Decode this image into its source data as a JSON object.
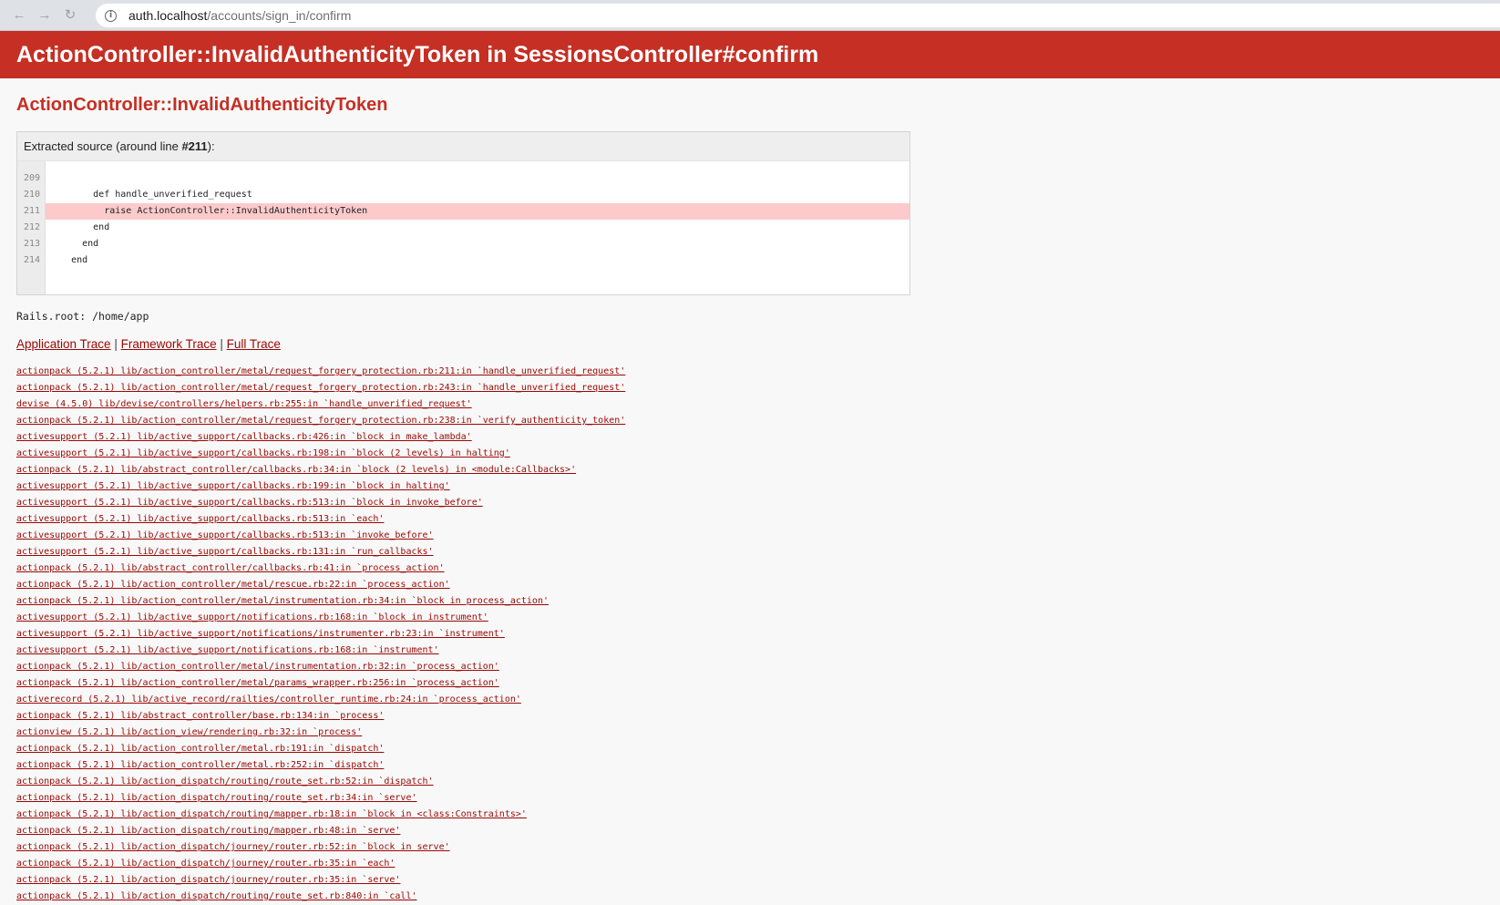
{
  "browser": {
    "url_host": "auth.localhost",
    "url_path": "/accounts/sign_in/confirm"
  },
  "header": {
    "title": "ActionController::InvalidAuthenticityToken in SessionsController#confirm"
  },
  "exception": {
    "name": "ActionController::InvalidAuthenticityToken"
  },
  "source": {
    "heading_prefix": "Extracted source (around line ",
    "heading_line": "#211",
    "heading_suffix": "):",
    "line_numbers": [
      "209",
      "210",
      "211",
      "212",
      "213",
      "214"
    ],
    "lines": [
      "",
      "        def handle_unverified_request",
      "          raise ActionController::InvalidAuthenticityToken",
      "        end",
      "      end",
      "    end"
    ],
    "highlighted_line": "211"
  },
  "rails_root": "Rails.root: /home/app",
  "trace_links": {
    "application": "Application Trace",
    "separator": " | ",
    "framework": "Framework Trace",
    "full": "Full Trace"
  },
  "trace": [
    "actionpack (5.2.1) lib/action_controller/metal/request_forgery_protection.rb:211:in `handle_unverified_request'",
    "actionpack (5.2.1) lib/action_controller/metal/request_forgery_protection.rb:243:in `handle_unverified_request'",
    "devise (4.5.0) lib/devise/controllers/helpers.rb:255:in `handle_unverified_request'",
    "actionpack (5.2.1) lib/action_controller/metal/request_forgery_protection.rb:238:in `verify_authenticity_token'",
    "activesupport (5.2.1) lib/active_support/callbacks.rb:426:in `block in make_lambda'",
    "activesupport (5.2.1) lib/active_support/callbacks.rb:198:in `block (2 levels) in halting'",
    "actionpack (5.2.1) lib/abstract_controller/callbacks.rb:34:in `block (2 levels) in <module:Callbacks>'",
    "activesupport (5.2.1) lib/active_support/callbacks.rb:199:in `block in halting'",
    "activesupport (5.2.1) lib/active_support/callbacks.rb:513:in `block in invoke_before'",
    "activesupport (5.2.1) lib/active_support/callbacks.rb:513:in `each'",
    "activesupport (5.2.1) lib/active_support/callbacks.rb:513:in `invoke_before'",
    "activesupport (5.2.1) lib/active_support/callbacks.rb:131:in `run_callbacks'",
    "actionpack (5.2.1) lib/abstract_controller/callbacks.rb:41:in `process_action'",
    "actionpack (5.2.1) lib/action_controller/metal/rescue.rb:22:in `process_action'",
    "actionpack (5.2.1) lib/action_controller/metal/instrumentation.rb:34:in `block in process_action'",
    "activesupport (5.2.1) lib/active_support/notifications.rb:168:in `block in instrument'",
    "activesupport (5.2.1) lib/active_support/notifications/instrumenter.rb:23:in `instrument'",
    "activesupport (5.2.1) lib/active_support/notifications.rb:168:in `instrument'",
    "actionpack (5.2.1) lib/action_controller/metal/instrumentation.rb:32:in `process_action'",
    "actionpack (5.2.1) lib/action_controller/metal/params_wrapper.rb:256:in `process_action'",
    "activerecord (5.2.1) lib/active_record/railties/controller_runtime.rb:24:in `process_action'",
    "actionpack (5.2.1) lib/abstract_controller/base.rb:134:in `process'",
    "actionview (5.2.1) lib/action_view/rendering.rb:32:in `process'",
    "actionpack (5.2.1) lib/action_controller/metal.rb:191:in `dispatch'",
    "actionpack (5.2.1) lib/action_controller/metal.rb:252:in `dispatch'",
    "actionpack (5.2.1) lib/action_dispatch/routing/route_set.rb:52:in `dispatch'",
    "actionpack (5.2.1) lib/action_dispatch/routing/route_set.rb:34:in `serve'",
    "actionpack (5.2.1) lib/action_dispatch/routing/mapper.rb:18:in `block in <class:Constraints>'",
    "actionpack (5.2.1) lib/action_dispatch/routing/mapper.rb:48:in `serve'",
    "actionpack (5.2.1) lib/action_dispatch/journey/router.rb:52:in `block in serve'",
    "actionpack (5.2.1) lib/action_dispatch/journey/router.rb:35:in `each'",
    "actionpack (5.2.1) lib/action_dispatch/journey/router.rb:35:in `serve'",
    "actionpack (5.2.1) lib/action_dispatch/routing/route_set.rb:840:in `call'"
  ]
}
